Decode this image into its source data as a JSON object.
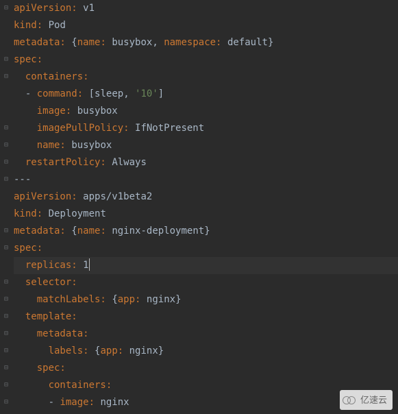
{
  "watermark": "亿速云",
  "lines": [
    {
      "indent": 0,
      "tokens": [
        {
          "t": "key",
          "v": "apiVersion:"
        },
        {
          "t": "sp",
          "v": " "
        },
        {
          "t": "val",
          "v": "v1"
        }
      ]
    },
    {
      "indent": 0,
      "tokens": [
        {
          "t": "key",
          "v": "kind:"
        },
        {
          "t": "sp",
          "v": " "
        },
        {
          "t": "val",
          "v": "Pod"
        }
      ]
    },
    {
      "indent": 0,
      "tokens": [
        {
          "t": "key",
          "v": "metadata:"
        },
        {
          "t": "sp",
          "v": " "
        },
        {
          "t": "brace",
          "v": "{"
        },
        {
          "t": "key",
          "v": "name:"
        },
        {
          "t": "sp",
          "v": " "
        },
        {
          "t": "val",
          "v": "busybox"
        },
        {
          "t": "val",
          "v": ", "
        },
        {
          "t": "key",
          "v": "namespace:"
        },
        {
          "t": "sp",
          "v": " "
        },
        {
          "t": "val",
          "v": "default"
        },
        {
          "t": "brace",
          "v": "}"
        }
      ]
    },
    {
      "indent": 0,
      "tokens": [
        {
          "t": "key",
          "v": "spec:"
        }
      ]
    },
    {
      "indent": 1,
      "tokens": [
        {
          "t": "key",
          "v": "containers:"
        }
      ]
    },
    {
      "indent": 1,
      "tokens": [
        {
          "t": "dash",
          "v": "- "
        },
        {
          "t": "key",
          "v": "command:"
        },
        {
          "t": "sp",
          "v": " "
        },
        {
          "t": "brace",
          "v": "["
        },
        {
          "t": "val",
          "v": "sleep"
        },
        {
          "t": "val",
          "v": ", "
        },
        {
          "t": "str",
          "v": "'10'"
        },
        {
          "t": "brace",
          "v": "]"
        }
      ]
    },
    {
      "indent": 2,
      "tokens": [
        {
          "t": "key",
          "v": "image:"
        },
        {
          "t": "sp",
          "v": " "
        },
        {
          "t": "val",
          "v": "busybox"
        }
      ]
    },
    {
      "indent": 2,
      "tokens": [
        {
          "t": "key",
          "v": "imagePullPolicy:"
        },
        {
          "t": "sp",
          "v": " "
        },
        {
          "t": "val",
          "v": "IfNotPresent"
        }
      ]
    },
    {
      "indent": 2,
      "tokens": [
        {
          "t": "key",
          "v": "name:"
        },
        {
          "t": "sp",
          "v": " "
        },
        {
          "t": "val",
          "v": "busybox"
        }
      ]
    },
    {
      "indent": 1,
      "tokens": [
        {
          "t": "key",
          "v": "restartPolicy:"
        },
        {
          "t": "sp",
          "v": " "
        },
        {
          "t": "val",
          "v": "Always"
        }
      ]
    },
    {
      "indent": 0,
      "tokens": [
        {
          "t": "sep",
          "v": "---"
        }
      ]
    },
    {
      "indent": 0,
      "tokens": [
        {
          "t": "key",
          "v": "apiVersion:"
        },
        {
          "t": "sp",
          "v": " "
        },
        {
          "t": "val",
          "v": "apps/v1beta2"
        }
      ]
    },
    {
      "indent": 0,
      "tokens": [
        {
          "t": "key",
          "v": "kind:"
        },
        {
          "t": "sp",
          "v": " "
        },
        {
          "t": "val",
          "v": "Deployment"
        }
      ]
    },
    {
      "indent": 0,
      "tokens": [
        {
          "t": "key",
          "v": "metadata:"
        },
        {
          "t": "sp",
          "v": " "
        },
        {
          "t": "brace",
          "v": "{"
        },
        {
          "t": "key",
          "v": "name:"
        },
        {
          "t": "sp",
          "v": " "
        },
        {
          "t": "val",
          "v": "nginx-deployment"
        },
        {
          "t": "brace",
          "v": "}"
        }
      ]
    },
    {
      "indent": 0,
      "tokens": [
        {
          "t": "key",
          "v": "spec:"
        }
      ]
    },
    {
      "indent": 1,
      "current": true,
      "caret": true,
      "tokens": [
        {
          "t": "key",
          "v": "replicas:"
        },
        {
          "t": "sp",
          "v": " "
        },
        {
          "t": "val",
          "v": "1"
        }
      ]
    },
    {
      "indent": 1,
      "tokens": [
        {
          "t": "key",
          "v": "selector:"
        }
      ]
    },
    {
      "indent": 2,
      "tokens": [
        {
          "t": "key",
          "v": "matchLabels:"
        },
        {
          "t": "sp",
          "v": " "
        },
        {
          "t": "brace",
          "v": "{"
        },
        {
          "t": "key",
          "v": "app:"
        },
        {
          "t": "sp",
          "v": " "
        },
        {
          "t": "val",
          "v": "nginx"
        },
        {
          "t": "brace",
          "v": "}"
        }
      ]
    },
    {
      "indent": 1,
      "tokens": [
        {
          "t": "key",
          "v": "template:"
        }
      ]
    },
    {
      "indent": 2,
      "tokens": [
        {
          "t": "key",
          "v": "metadata:"
        }
      ]
    },
    {
      "indent": 3,
      "tokens": [
        {
          "t": "key",
          "v": "labels:"
        },
        {
          "t": "sp",
          "v": " "
        },
        {
          "t": "brace",
          "v": "{"
        },
        {
          "t": "key",
          "v": "app:"
        },
        {
          "t": "sp",
          "v": " "
        },
        {
          "t": "val",
          "v": "nginx"
        },
        {
          "t": "brace",
          "v": "}"
        }
      ]
    },
    {
      "indent": 2,
      "tokens": [
        {
          "t": "key",
          "v": "spec:"
        }
      ]
    },
    {
      "indent": 3,
      "tokens": [
        {
          "t": "key",
          "v": "containers:"
        }
      ]
    },
    {
      "indent": 3,
      "tokens": [
        {
          "t": "dash",
          "v": "- "
        },
        {
          "t": "key",
          "v": "image:"
        },
        {
          "t": "sp",
          "v": " "
        },
        {
          "t": "val",
          "v": "nginx"
        }
      ]
    }
  ],
  "fold_rows": [
    0,
    3,
    4,
    7,
    8,
    9,
    10,
    13,
    14,
    16,
    17,
    18,
    19,
    20,
    21,
    22,
    23
  ]
}
